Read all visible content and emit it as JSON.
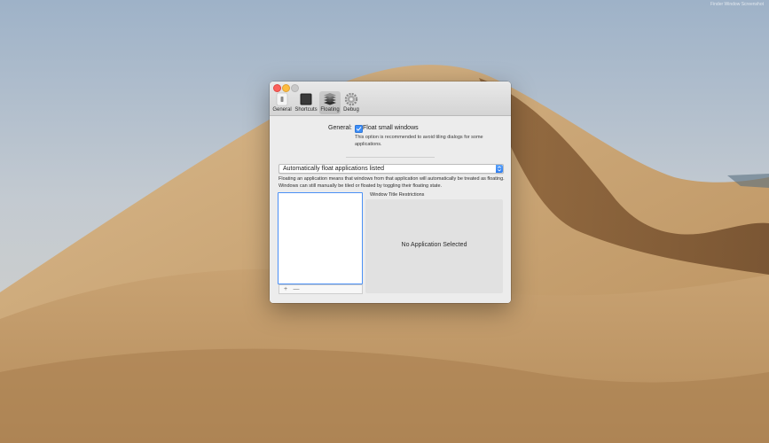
{
  "desktop": {
    "corner_text": "Finder Window Screenshot"
  },
  "window": {
    "toolbar": [
      {
        "label": "General",
        "icon": "general-icon",
        "selected": false
      },
      {
        "label": "Shortcuts",
        "icon": "shortcuts-icon",
        "selected": false
      },
      {
        "label": "Floating",
        "icon": "floating-icon",
        "selected": true
      },
      {
        "label": "Debug",
        "icon": "debug-icon",
        "selected": false
      }
    ],
    "general": {
      "label": "General:",
      "checkbox_label": "Float small windows",
      "checkbox_checked": true,
      "help_text": "This option is recommended to avoid tiling dialogs for some applications."
    },
    "floating": {
      "popup_value": "Automatically float applications listed",
      "description": "Floating an application means that windows from that application will automatically be treated as floating. Windows can still manually be tiled or floated by toggling their floating state.",
      "add_label": "+",
      "remove_label": "—",
      "restrictions_header": "Window Title Restrictions",
      "empty_state": "No Application Selected"
    }
  },
  "colors": {
    "accent": "#3d8ef7",
    "close": "#fc605b",
    "minimize": "#fdbc40",
    "zoom": "#c9c9c9"
  }
}
